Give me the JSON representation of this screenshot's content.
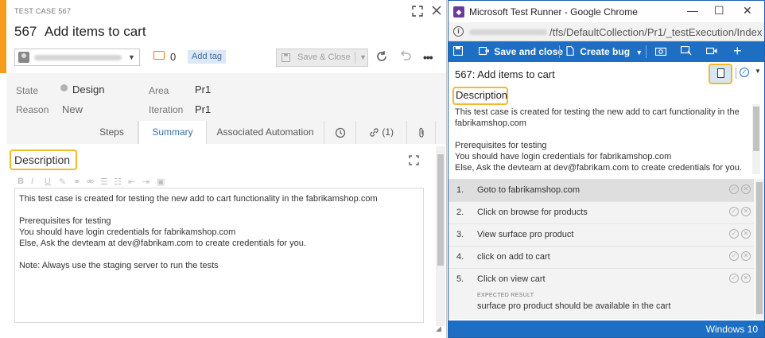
{
  "work_item": {
    "type_label": "TEST CASE 567",
    "id": "567",
    "title": "Add items to cart",
    "comment_count": "0",
    "add_tag_label": "Add tag",
    "save_close_label": "Save & Close",
    "fields": {
      "state_label": "State",
      "state_value": "Design",
      "reason_label": "Reason",
      "reason_value": "New",
      "area_label": "Area",
      "area_value": "Pr1",
      "iteration_label": "Iteration",
      "iteration_value": "Pr1"
    },
    "tabs": [
      {
        "label": "Steps"
      },
      {
        "label": "Summary"
      },
      {
        "label": "Associated Automation"
      },
      {
        "label": "(1)"
      }
    ],
    "description_heading": "Description",
    "description_lines": [
      "This test case is created for testing the new add to cart functionality in the fabrikamshop.com",
      "",
      "Prerequisites for testing",
      "You should have login credentials for fabrikamshop.com",
      "Else, Ask the devteam at dev@fabrikam.com to create credentials for you.",
      "",
      "Note: Always use the staging server to run the tests"
    ],
    "editor_toolbar": [
      "B",
      "I",
      "U"
    ]
  },
  "runner": {
    "window_title": "Microsoft Test Runner - Google Chrome",
    "url_path": "/tfs/DefaultCollection/Pr1/_testExecution/Index",
    "toolbar": {
      "save_close": "Save and close",
      "create_bug": "Create bug"
    },
    "test_title": "567: Add items to cart",
    "description_heading": "Description",
    "description_lines": [
      "This test case is created for testing the new add to cart functionality in the",
      "fabrikamshop.com",
      "",
      "Prerequisites for testing",
      "You should have login credentials for fabrikamshop.com",
      "Else, Ask the devteam at dev@fabrikam.com to create credentials for you."
    ],
    "steps": [
      {
        "num": "1.",
        "text": "Goto to fabrikamshop.com"
      },
      {
        "num": "2.",
        "text": " Click on browse for products"
      },
      {
        "num": "3.",
        "text": "View surface pro product"
      },
      {
        "num": "4.",
        "text": "click on add to cart"
      },
      {
        "num": "5.",
        "text": "Click on view cart"
      }
    ],
    "expected_result_label": "EXPECTED RESULT",
    "expected_result": "surface pro product should be available in the cart",
    "status_text": "Windows 10"
  },
  "colors": {
    "accent": "#1e6fc4",
    "highlight": "#f2b92a",
    "work_item_bar": "#f59c1c"
  }
}
